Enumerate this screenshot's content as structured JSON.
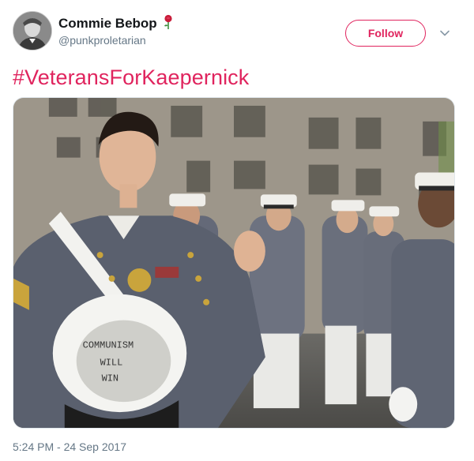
{
  "tweet": {
    "author": {
      "display_name": "Commie Bebop",
      "handle": "@punkproletarian",
      "name_emoji": "rose-icon",
      "avatar": "avatar-portrait"
    },
    "follow_label": "Follow",
    "text": "#VeteransForKaepernick",
    "photo": {
      "cap_text": [
        "COMMUNISM",
        "WILL",
        "WIN"
      ]
    },
    "timestamp": "5:24 PM - 24 Sep 2017"
  },
  "colors": {
    "accent": "#e0245e",
    "secondary_text": "#657786",
    "primary_text": "#14171a"
  }
}
